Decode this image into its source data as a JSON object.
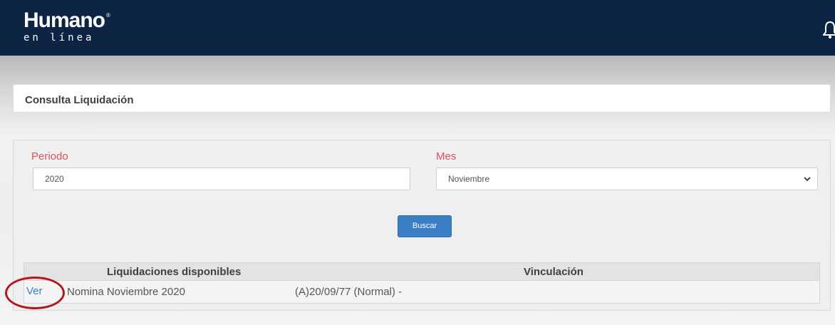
{
  "header": {
    "logo_main": "Humano",
    "logo_reg": "®",
    "logo_sub": "en línea",
    "icon": "bell-icon"
  },
  "page": {
    "title": "Consulta Liquidación"
  },
  "form": {
    "periodo_label": "Periodo",
    "periodo_value": "2020",
    "mes_label": "Mes",
    "mes_value": "Noviembre",
    "chevron_icon": "chevron-down-icon",
    "buscar_label": "Buscar"
  },
  "table": {
    "headers": [
      "Liquidaciones disponibles",
      "Vinculación"
    ],
    "rows": [
      {
        "action": "Ver",
        "nomina": "Nomina Noviembre 2020",
        "vinculacion": "(A)20/09/77 (Normal) -"
      }
    ]
  },
  "colors": {
    "header_bg": "#0e2444",
    "label_accent": "#d9535f",
    "button_bg": "#3b7fc4",
    "annotation": "#b0181e"
  }
}
